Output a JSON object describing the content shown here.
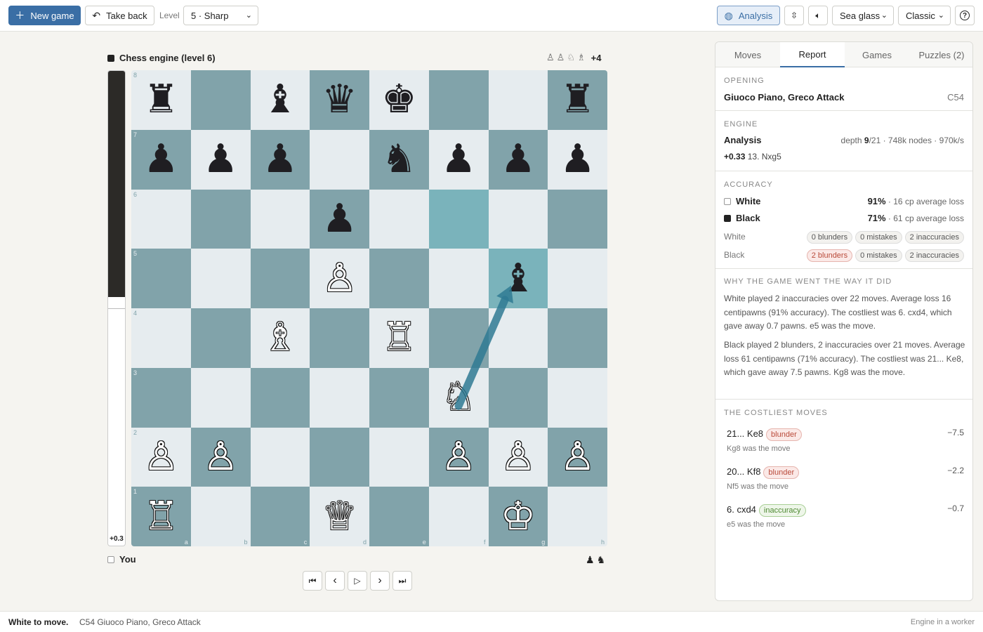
{
  "toolbar": {
    "new_game": "New game",
    "take_back": "Take back",
    "level_label": "Level",
    "level_value": "5 · Sharp",
    "analysis": "Analysis",
    "theme_value": "Sea glass",
    "pieces_value": "Classic",
    "help": "?"
  },
  "players": {
    "top_name": "Chess engine (level 6)",
    "top_captured": [
      "♙",
      "♙",
      "♘",
      "♗"
    ],
    "top_advantage": "+4",
    "bottom_name": "You",
    "bottom_captured": [
      "♟",
      "♞"
    ]
  },
  "eval": {
    "label": "+0.3",
    "white_fraction": 0.52
  },
  "board": {
    "ranks": [
      "8",
      "7",
      "6",
      "5",
      "4",
      "3",
      "2",
      "1"
    ],
    "files": [
      "a",
      "b",
      "c",
      "d",
      "e",
      "f",
      "g",
      "h"
    ],
    "highlights": [
      "f6",
      "g5"
    ],
    "arrow": {
      "from": "f3",
      "to": "g5",
      "color": "#2f7a93"
    },
    "pieces": [
      {
        "sq": "a8",
        "p": "♜",
        "side": "b"
      },
      {
        "sq": "c8",
        "p": "♝",
        "side": "b"
      },
      {
        "sq": "d8",
        "p": "♛",
        "side": "b"
      },
      {
        "sq": "e8",
        "p": "♚",
        "side": "b"
      },
      {
        "sq": "h8",
        "p": "♜",
        "side": "b"
      },
      {
        "sq": "a7",
        "p": "♟",
        "side": "b"
      },
      {
        "sq": "b7",
        "p": "♟",
        "side": "b"
      },
      {
        "sq": "c7",
        "p": "♟",
        "side": "b"
      },
      {
        "sq": "e7",
        "p": "♞",
        "side": "b"
      },
      {
        "sq": "f7",
        "p": "♟",
        "side": "b"
      },
      {
        "sq": "g7",
        "p": "♟",
        "side": "b"
      },
      {
        "sq": "h7",
        "p": "♟",
        "side": "b"
      },
      {
        "sq": "d6",
        "p": "♟",
        "side": "b"
      },
      {
        "sq": "d5",
        "p": "♙",
        "side": "w"
      },
      {
        "sq": "g5",
        "p": "♝",
        "side": "b"
      },
      {
        "sq": "c4",
        "p": "♗",
        "side": "w"
      },
      {
        "sq": "e4",
        "p": "♖",
        "side": "w"
      },
      {
        "sq": "f3",
        "p": "♘",
        "side": "w"
      },
      {
        "sq": "a2",
        "p": "♙",
        "side": "w"
      },
      {
        "sq": "b2",
        "p": "♙",
        "side": "w"
      },
      {
        "sq": "f2",
        "p": "♙",
        "side": "w"
      },
      {
        "sq": "g2",
        "p": "♙",
        "side": "w"
      },
      {
        "sq": "h2",
        "p": "♙",
        "side": "w"
      },
      {
        "sq": "a1",
        "p": "♖",
        "side": "w"
      },
      {
        "sq": "d1",
        "p": "♕",
        "side": "w"
      },
      {
        "sq": "g1",
        "p": "♔",
        "side": "w"
      }
    ]
  },
  "nav": {
    "first": "⏮",
    "prev": "‹",
    "play": "▷",
    "next": "›",
    "last": "⏭"
  },
  "panel": {
    "tabs": [
      "Moves",
      "Report",
      "Games",
      "Puzzles (2)"
    ],
    "active_tab": 1,
    "opening": {
      "title": "Opening",
      "name": "Giuoco Piano, Greco Attack",
      "eco": "C54"
    },
    "engine": {
      "title": "Engine",
      "label": "Analysis",
      "depth_prefix": "depth ",
      "depth": "9",
      "depth_suffix": "/21 · 748k nodes · 970k/s",
      "score": "+0.33",
      "line": "13. Nxg5"
    },
    "accuracy": {
      "title": "Accuracy",
      "white_name": "White",
      "white_pct": "91%",
      "white_loss": " · 16 cp average loss",
      "black_name": "Black",
      "black_pct": "71%",
      "black_loss": " · 61 cp average loss",
      "row_white": "White",
      "row_black": "Black",
      "white_pills": [
        "0 blunders",
        "0 mistakes",
        "2 inaccuracies"
      ],
      "black_pills": [
        "2 blunders",
        "0 mistakes",
        "2 inaccuracies"
      ]
    },
    "why": {
      "title": "Why the game went the way it did",
      "white_text": "White played 2 inaccuracies over 22 moves. Average loss 16 centipawns (91% accuracy). The costliest was 6. cxd4, which gave away 0.7 pawns. e5 was the move.",
      "black_text": "Black played 2 blunders, 2 inaccuracies over 21 moves. Average loss 61 centipawns (71% accuracy). The costliest was 21... Ke8, which gave away 7.5 pawns. Kg8 was the move."
    },
    "costliest": {
      "title": "The costliest moves",
      "moves": [
        {
          "move": "21... Ke8",
          "tag": "blunder",
          "kind": "red",
          "best": "Kg8 was the move",
          "loss": "−7.5"
        },
        {
          "move": "20... Kf8",
          "tag": "blunder",
          "kind": "red",
          "best": "Nf5 was the move",
          "loss": "−2.2"
        },
        {
          "move": "6. cxd4",
          "tag": "inaccuracy",
          "kind": "green",
          "best": "e5 was the move",
          "loss": "−0.7"
        }
      ]
    }
  },
  "status": {
    "turn": "White to move.",
    "opening": "C54 Giuoco Piano, Greco Attack",
    "engine": "Engine in a worker"
  }
}
